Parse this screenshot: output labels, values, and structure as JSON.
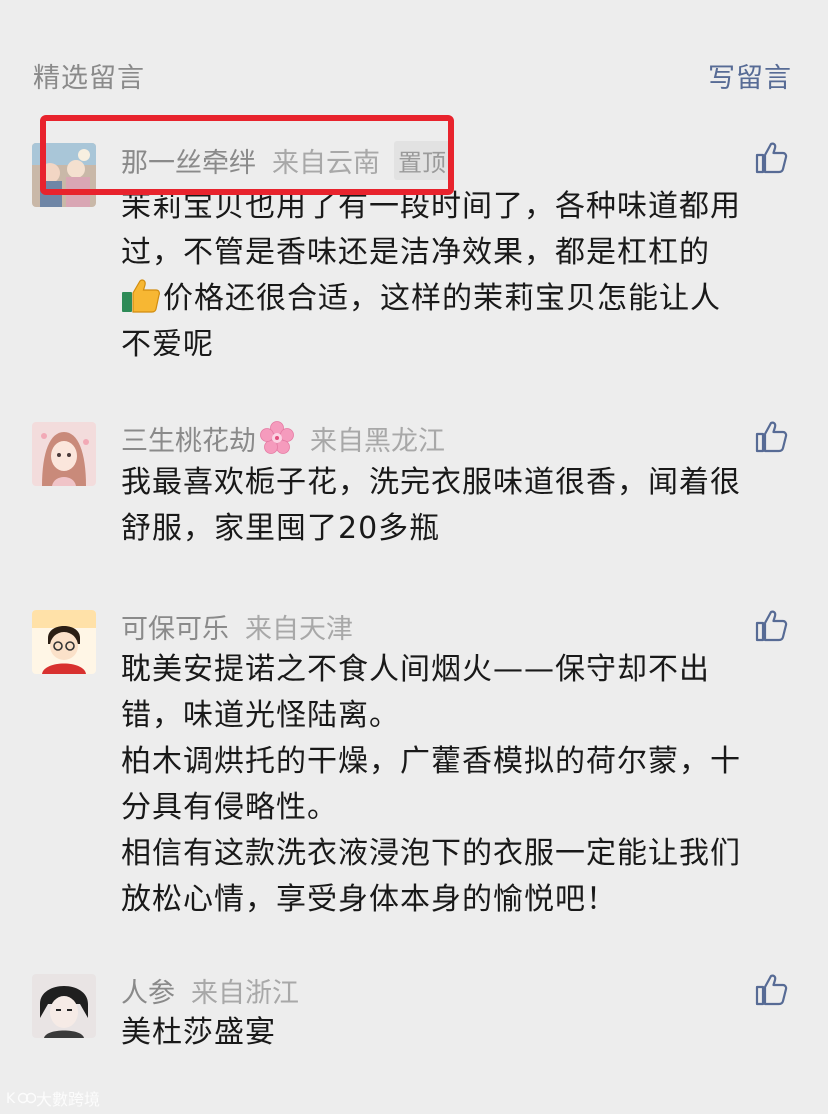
{
  "header": {
    "title": "精选留言",
    "write_label": "写留言"
  },
  "colors": {
    "background": "#ededed",
    "link": "#576b95",
    "meta": "#8a8a8a",
    "highlight": "#e8232d"
  },
  "comments": [
    {
      "name": "那一丝牵绊",
      "origin": "来自云南",
      "pinned_label": "置顶",
      "avatar_icon": "avatar-illustration",
      "lines": [
        "茉莉宝贝也用了有一段时间了，各种味道都用",
        "过，不管是香味还是洁净效果，都是杠杠的",
        "价格还很合适，这样的茉莉宝贝怎能让人",
        "不爱呢"
      ],
      "line3_emoji": "thumbs-up-emoji"
    },
    {
      "name": "三生桃花劫",
      "name_emoji": "cherry-blossom-emoji",
      "origin": "来自黑龙江",
      "avatar_icon": "avatar-anime-girl",
      "lines": [
        "我最喜欢栀子花，洗完衣服味道很香，闻着很",
        "舒服，家里囤了20多瓶"
      ]
    },
    {
      "name": "可保可乐",
      "origin": "来自天津",
      "avatar_icon": "avatar-cartoon-boy",
      "lines": [
        "耽美安提诺之不食人间烟火——保守却不出",
        "错，味道光怪陆离。",
        "柏木调烘托的干燥，广藿香模拟的荷尔蒙，十",
        "分具有侵略性。",
        "相信有这款洗衣液浸泡下的衣服一定能让我们",
        "放松心情，享受身体本身的愉悦吧！"
      ]
    },
    {
      "name": "人参",
      "origin": "来自浙江",
      "avatar_icon": "avatar-manga-character",
      "lines": [
        "美杜莎盛宴"
      ]
    }
  ],
  "watermark": {
    "text": "大數跨境"
  }
}
